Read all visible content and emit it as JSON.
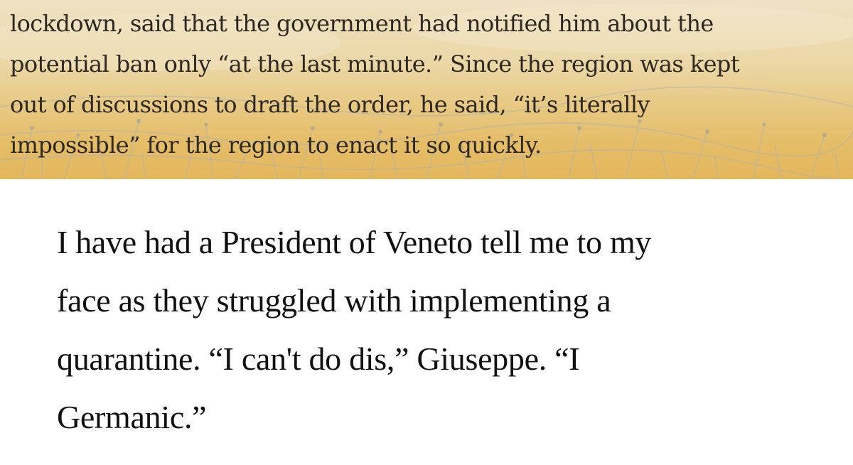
{
  "article_excerpt": {
    "lines": [
      "lockdown, said that the government had notified him about the",
      "potential ban only “at the last minute.” Since the region was kept",
      "out of discussions to draft the order, he said, “it’s literally",
      "impossible” for the region to enact it so quickly."
    ]
  },
  "comment": {
    "lines": [
      "I have had a President of Veneto tell me to my",
      "face as they struggled with implementing a",
      "quarantine. “I can't do dis,” Giuseppe. “I",
      "Germanic.”"
    ]
  },
  "colors": {
    "excerpt_background_top": "#efe2c3",
    "excerpt_background_bottom": "#e3b75c",
    "excerpt_text": "#2d2922",
    "comment_background": "#ffffff",
    "comment_text": "#111111"
  }
}
